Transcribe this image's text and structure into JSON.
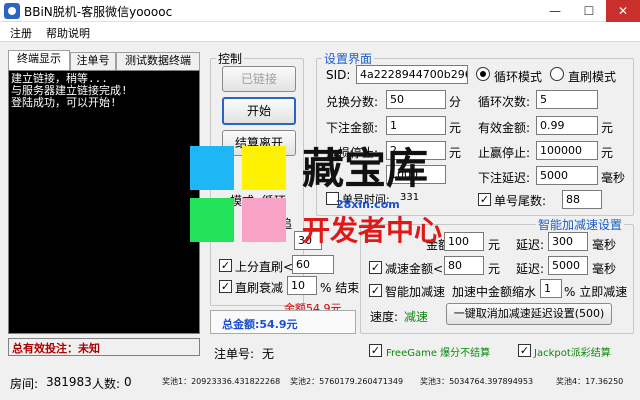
{
  "window": {
    "title": "BBiN脱机-客服微信yooooc",
    "min": "—",
    "max": "☐",
    "close": "✕"
  },
  "menu": {
    "items": [
      "注册",
      "帮助说明"
    ]
  },
  "tabs": [
    "终端显示",
    "注单号",
    "测试数据终端"
  ],
  "console": {
    "lines": [
      "建立链接，稍等...",
      "与服务器建立链接完成!",
      "登陆成功，可以开始!"
    ]
  },
  "total_effective": "总有效投注：未知",
  "status": {
    "room_label": "房间:",
    "room_value": "381983",
    "people_label": "人数:",
    "people_value": "0"
  },
  "bonuses": [
    "奖池1：20923336.431822268",
    "奖池2：5760179.260471349",
    "奖池3：5034764.397894953",
    "奖池4：17.36250"
  ],
  "control": {
    "title": "控制",
    "linked_button": "已链接",
    "start_button": "开始",
    "settle_button": "结算离开",
    "partial_a": "模式",
    "partial_b": "循环",
    "partial_c": "追",
    "partial_value": "30",
    "upshift_label": "上分直刷<",
    "upshift_value": "60",
    "decay_label": "直刷衰减",
    "decay_value": "10",
    "decay_suffix": "% 结束",
    "balance_remain": "余额54.9元",
    "total_balance": "总金额:54.9元"
  },
  "settings": {
    "title": "设置界面",
    "sid_label": "SID:",
    "sid_value": "4a2228944700b2961d",
    "loop_mode": "循环模式",
    "direct_mode": "直刷模式",
    "exchange_label": "兑换分数:",
    "exchange_value": "50",
    "exchange_unit": "分",
    "loop_count_label": "循环次数:",
    "loop_count_value": "5",
    "bet_label": "下注金额:",
    "bet_value": "1",
    "bet_unit": "元",
    "valid_label": "有效金额:",
    "valid_value": "0.99",
    "valid_unit": "元",
    "stoploss_label": "止损停止:",
    "stoploss_value": "2",
    "stoploss_unit": "元",
    "stopwin_label": "止赢停止:",
    "stopwin_value": "100000",
    "stopwin_unit": "元",
    "delay_label": "下注延迟:",
    "delay_value": "5000",
    "delay_unit": "毫秒",
    "tail_label": "单号尾数:",
    "tail_value": "88",
    "mid_value": "1000",
    "order_time_label": "单号时间:",
    "order_time_value": "331"
  },
  "accel": {
    "title": "智能加减速设置",
    "speed_up_suffix": "金额>",
    "speed_up_value": "100",
    "speed_up_unit": "元",
    "delay1_label": "延迟:",
    "delay1_value": "300",
    "delay1_unit": "毫秒",
    "slow_label": "减速金额<",
    "slow_value": "80",
    "slow_unit": "元",
    "delay2_label": "延迟:",
    "delay2_value": "5000",
    "delay2_unit": "毫秒",
    "smart_label": "智能加减速",
    "shrink_label": "加速中金额缩水",
    "shrink_value": "1",
    "shrink_suffix": "% 立即减速",
    "speed_label": "速度:",
    "speed_value": "减速",
    "cancel_button": "一键取消加减速延迟设置(500)"
  },
  "footer": {
    "order_label": "注单号:",
    "order_value": "无",
    "freegame": "FreeGame 爆分不结算",
    "jackpot": "Jackpot派彩结算"
  },
  "watermark": {
    "line1": "藏宝库",
    "line2": "28xin.com",
    "line3": "开发者中心"
  },
  "colors": {
    "accent": "#2a64c4",
    "warning": "#d00000",
    "success": "#0a8a0a"
  }
}
